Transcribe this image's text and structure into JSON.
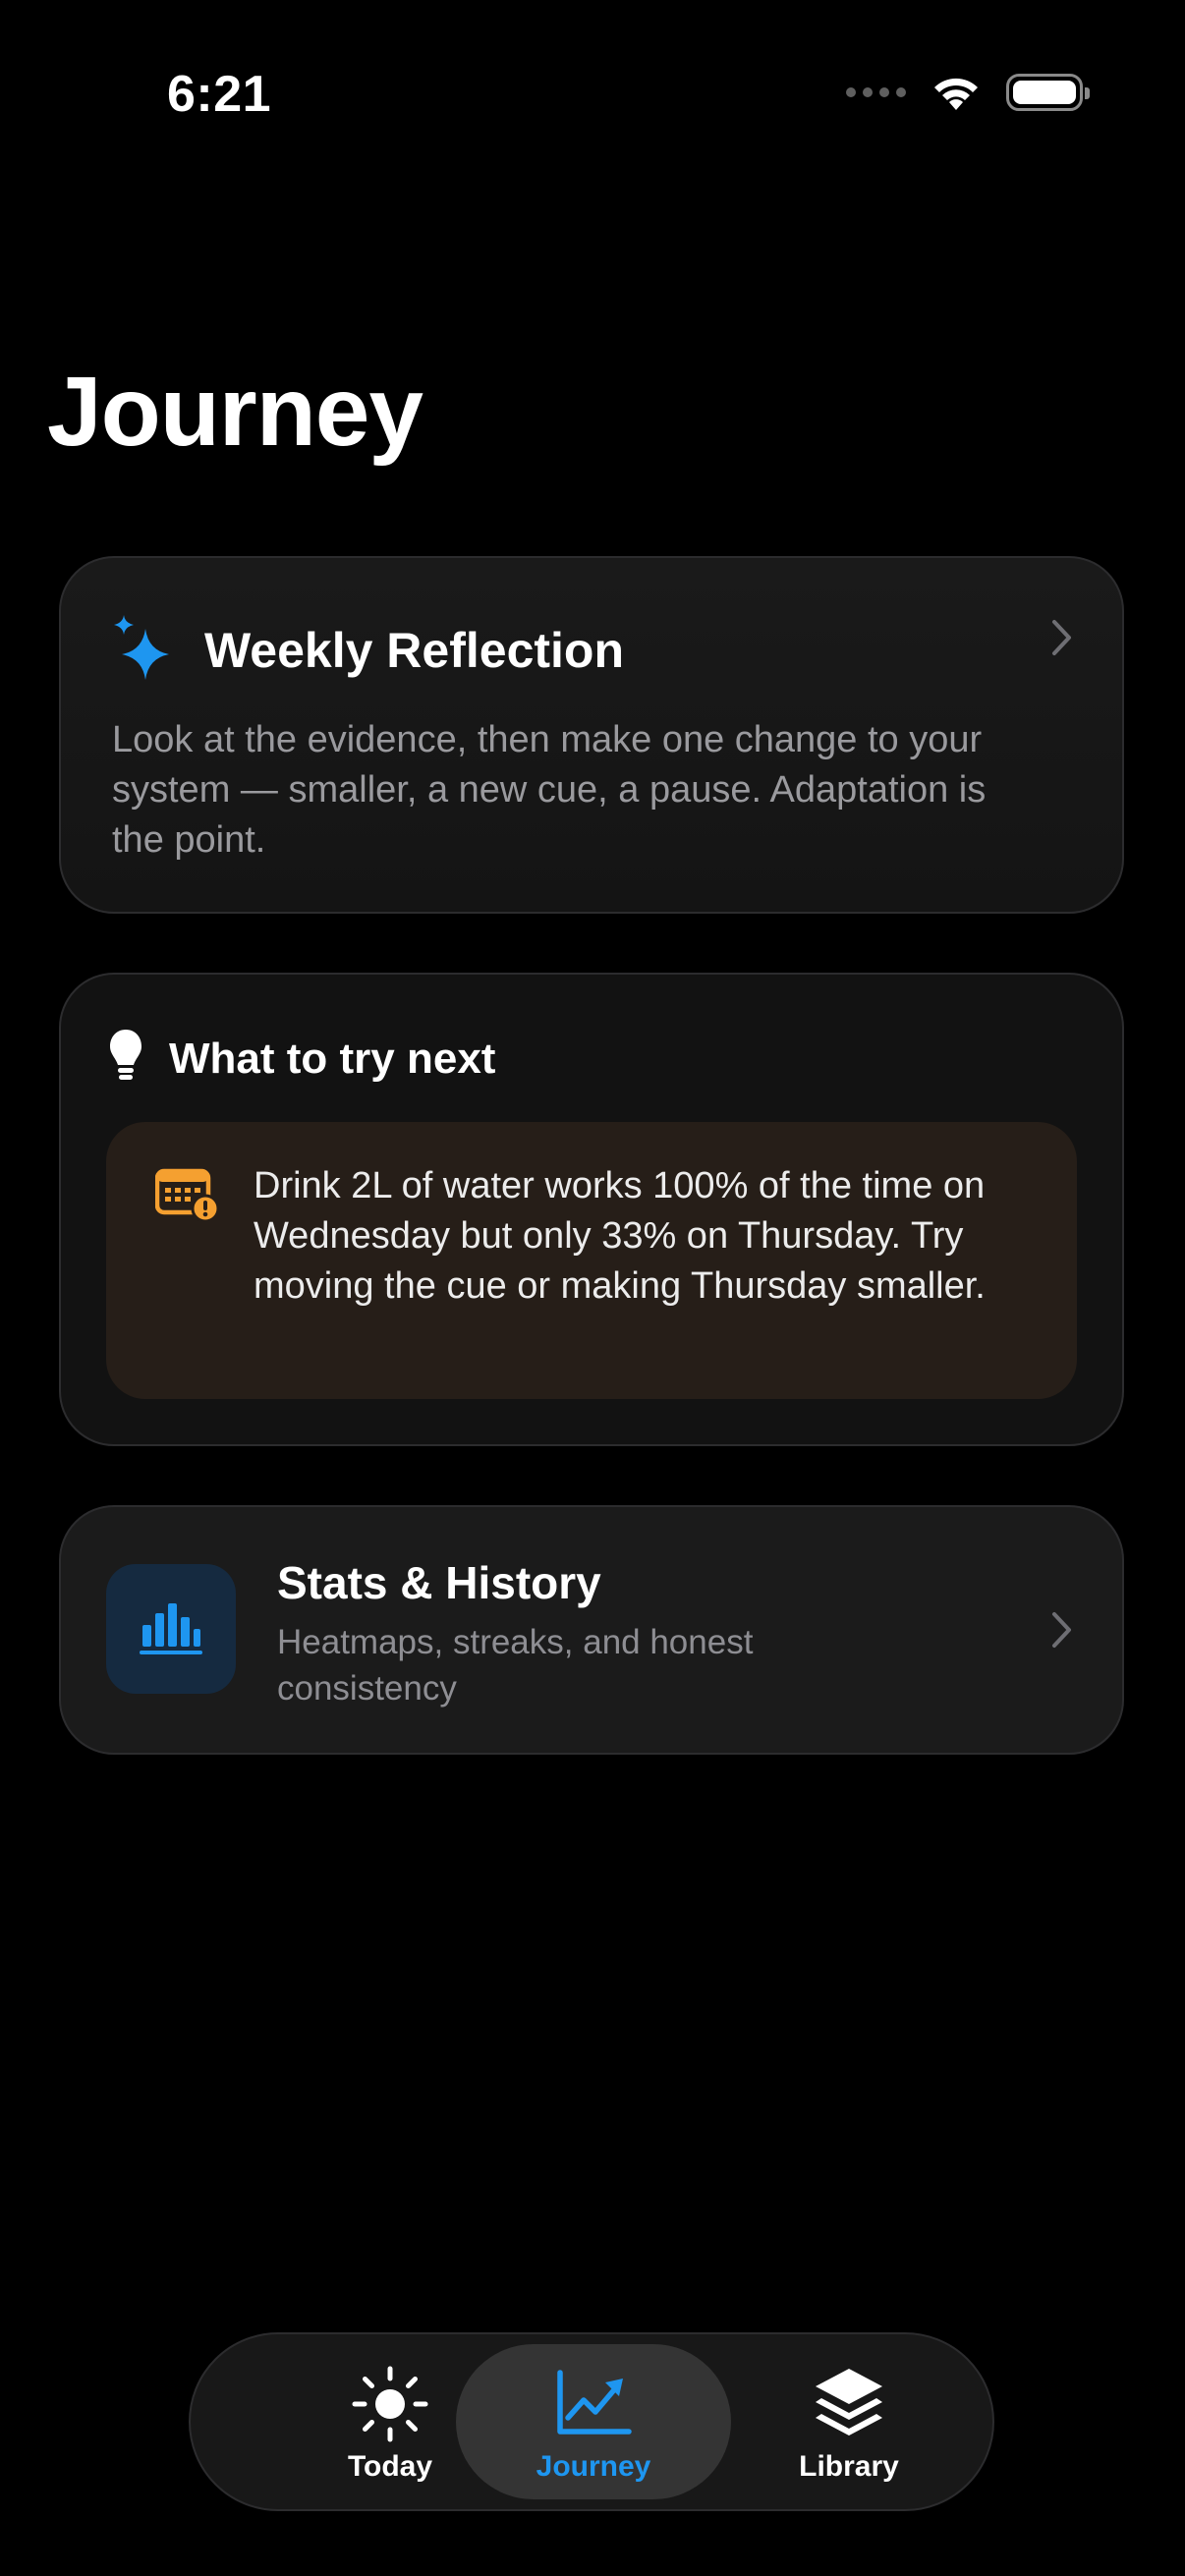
{
  "status_bar": {
    "time": "6:21"
  },
  "page": {
    "title": "Journey"
  },
  "colors": {
    "accent_blue": "#1E96F0",
    "warning_orange": "#F5A030",
    "card_background": "#151515",
    "suggestion_background": "#261E18"
  },
  "reflection_card": {
    "icon": "sparkles-icon",
    "title": "Weekly Reflection",
    "body": "Look at the evidence, then make one change to your system — smaller, a new cue, a pause. Adaptation is the point."
  },
  "try_next_card": {
    "icon": "lightbulb-icon",
    "title": "What to try next",
    "suggestion": {
      "icon": "calendar-warning-icon",
      "text": "Drink 2L of water works 100% of the time on Wednesday but only 33% on Thursday. Try moving the cue or making Thursday smaller."
    }
  },
  "stats_card": {
    "icon": "bar-chart-icon",
    "title": "Stats & History",
    "subtitle": "Heatmaps, streaks, and honest consistency"
  },
  "tab_bar": {
    "selected": "Journey",
    "tabs": [
      {
        "label": "Today",
        "icon": "sun-icon"
      },
      {
        "label": "Journey",
        "icon": "trend-chart-icon"
      },
      {
        "label": "Library",
        "icon": "stack-icon"
      }
    ]
  }
}
